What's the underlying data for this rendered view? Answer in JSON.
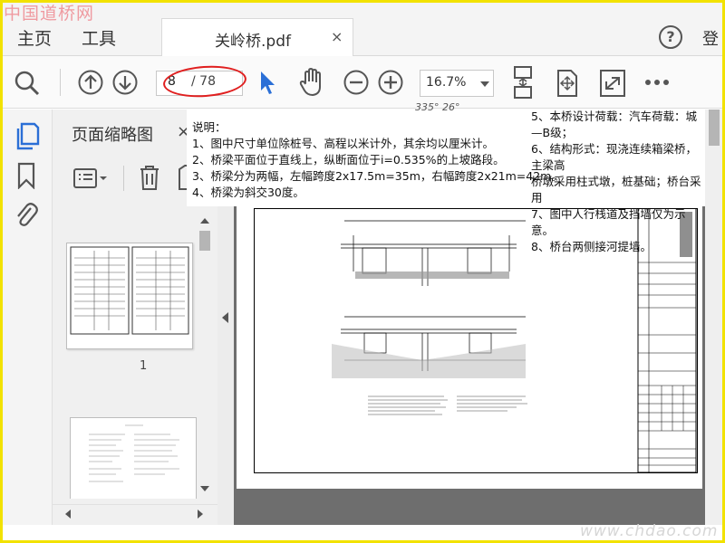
{
  "watermark": {
    "top": "中国道桥网",
    "bottom": "www.chdao.com"
  },
  "topbar": {
    "home": "主页",
    "tools": "工具",
    "tab_title": "关岭桥.pdf",
    "tab_close": "×",
    "help": "?",
    "login": "登"
  },
  "toolbar": {
    "page_current": "8",
    "page_total": "/ 78",
    "zoom": "16.7%",
    "icons": [
      "search-icon",
      "page-up-icon",
      "page-down-icon",
      "select-cursor-icon",
      "hand-icon",
      "zoom-out-icon",
      "zoom-in-icon",
      "fit-page-icon",
      "rotate-icon",
      "full-screen-icon",
      "more-icon"
    ],
    "accent_color": "#2b6fd6",
    "annotation_color": "#e01f1f"
  },
  "thumbnail_panel": {
    "title": "页面缩略图",
    "close": "×",
    "thumbnails": [
      {
        "number": "1"
      },
      {
        "number": ""
      }
    ]
  },
  "document": {
    "angle_label": "335° 26°",
    "notes_left": {
      "heading": "说明：",
      "items": [
        "1、图中尺寸单位除桩号、高程以米计外，其余均以厘米计。",
        "2、桥梁平面位于直线上，纵断面位于i=0.535%的上坡路段。",
        "3、桥梁分为两幅，左幅跨度2x17.5m=35m，右幅跨度2x21m=42m。",
        "4、桥梁为斜交30度。"
      ]
    },
    "notes_right": {
      "items": [
        "5、本桥设计荷载：汽车荷载：城—B级；",
        "6、结构形式：现浇连续箱梁桥，主梁高",
        "   桥墩采用柱式墩，桩基础；桥台采用",
        "7、图中人行栈道及挡墙仅为示意。",
        "8、桥台两侧接河提墙。"
      ]
    }
  }
}
